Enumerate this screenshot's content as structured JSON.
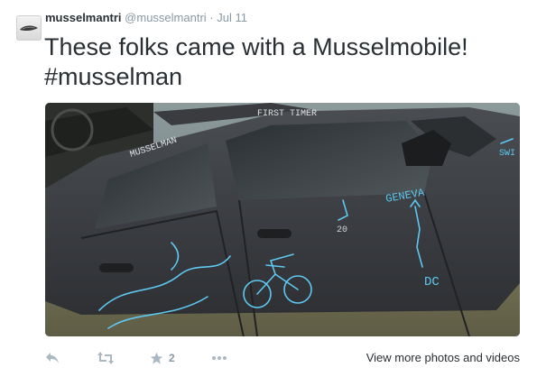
{
  "tweet": {
    "fullname": "musselmantri",
    "username": "@musselmantri",
    "separator": "·",
    "time": "Jul 11",
    "text_line1": "These folks came with a Musselmobile!",
    "text_line2": "#musselman"
  },
  "photo": {
    "scribbles": {
      "first_timer": "FIRST TIMER",
      "musselman": "MUSSELMAN",
      "geneva": "GENEVA",
      "dc": "DC",
      "number": "20",
      "edge": "SWI"
    }
  },
  "actions": {
    "reply_icon": "reply-icon",
    "retweet_icon": "retweet-icon",
    "favorite_icon": "star-icon",
    "favorite_count": "2",
    "more_icon": "more-icon",
    "view_more_label": "View more photos and videos"
  },
  "colors": {
    "text": "#292f33",
    "muted": "#8899a6",
    "action_icon": "#aab8c2",
    "chalk": "#5ec8f2"
  }
}
